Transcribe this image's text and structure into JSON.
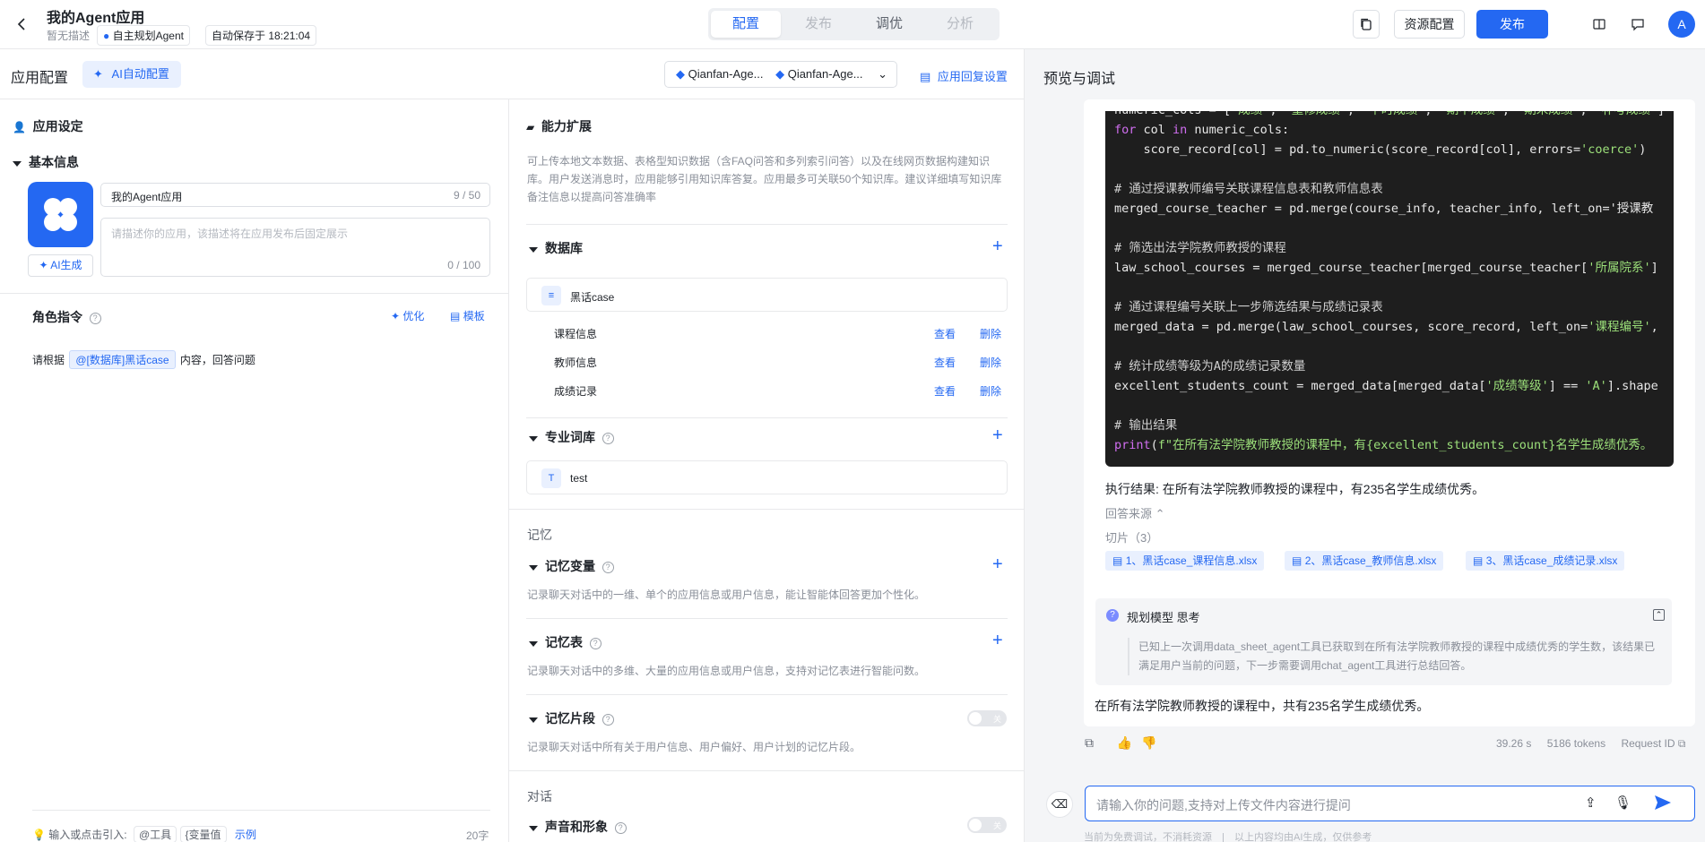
{
  "topbar": {
    "app_title": "我的Agent应用",
    "no_desc": "暂无描述",
    "agent_type": "自主规划Agent",
    "autosave": "自动保存于 18:21:04",
    "tabs": [
      "配置",
      "发布",
      "调优",
      "分析"
    ],
    "resource_btn": "资源配置",
    "publish_btn": "发布",
    "avatar": "A"
  },
  "config": {
    "title": "应用配置",
    "ai_auto": "AI自动配置",
    "model1": "Qianfan-Age...",
    "model2": "Qianfan-Age...",
    "reply_settings": "应用回复设置"
  },
  "app_settings": {
    "title": "应用设定",
    "basic_info": "基本信息",
    "name_value": "我的Agent应用",
    "name_count": "9 / 50",
    "desc_placeholder": "请描述你的应用，该描述将在应用发布后固定展示",
    "desc_count": "0 / 100",
    "ai_generate": "AI生成",
    "role_title": "角色指令",
    "optimize": "优化",
    "template": "模板",
    "instr_prefix": "请根据",
    "instr_tag": "@[数据库]黑话case",
    "instr_suffix": "内容，回答问题",
    "footer_hint": "输入或点击引入:",
    "footer_tool": "@工具",
    "footer_var": "{变量值",
    "footer_example": "示例",
    "footer_count": "20字"
  },
  "capability": {
    "title": "能力扩展",
    "desc": "可上传本地文本数据、表格型知识数据（含FAQ问答和多列索引问答）以及在线网页数据构建知识库。用户发送消息时，应用能够引用知识库答复。应用最多可关联50个知识库。建议详细填写知识库备注信息以提高问答准确率",
    "database": {
      "title": "数据库",
      "name": "黑话case",
      "tables": [
        {
          "name": "课程信息",
          "view": "查看",
          "del": "删除"
        },
        {
          "name": "教师信息",
          "view": "查看",
          "del": "删除"
        },
        {
          "name": "成绩记录",
          "view": "查看",
          "del": "删除"
        }
      ]
    },
    "terms": {
      "title": "专业词库",
      "item": "test"
    },
    "memory_label": "记忆",
    "mem_var": {
      "title": "记忆变量",
      "desc": "记录聊天对话中的一维、单个的应用信息或用户信息，能让智能体回答更加个性化。"
    },
    "mem_table": {
      "title": "记忆表",
      "desc": "记录聊天对话中的多维、大量的应用信息或用户信息，支持对记忆表进行智能问数。"
    },
    "mem_frag": {
      "title": "记忆片段",
      "desc": "记录聊天对话中所有关于用户信息、用户偏好、用户计划的记忆片段。",
      "toggle": "关"
    },
    "dialog_label": "对话",
    "voice": {
      "title": "声音和形象",
      "toggle": "关"
    }
  },
  "preview": {
    "title": "预览与调试",
    "code_lines": [
      "numeric_cols = ['成绩', '重修成绩', '平时成绩', '期中成绩', '期末成绩', '补考成绩']",
      "for col in numeric_cols:",
      "    score_record[col] = pd.to_numeric(score_record[col], errors='coerce')",
      "",
      "# 通过授课教师编号关联课程信息表和教师信息表",
      "merged_course_teacher = pd.merge(course_info, teacher_info, left_on='授课教",
      "",
      "# 筛选出法学院教师教授的课程",
      "law_school_courses = merged_course_teacher[merged_course_teacher['所属院系']",
      "",
      "# 通过课程编号关联上一步筛选结果与成绩记录表",
      "merged_data = pd.merge(law_school_courses, score_record, left_on='课程编号',",
      "",
      "# 统计成绩等级为A的成绩记录数量",
      "excellent_students_count = merged_data[merged_data['成绩等级'] == 'A'].shape",
      "",
      "# 输出结果",
      "print(f\"在所有法学院教师教授的课程中，有{excellent_students_count}名学生成绩优秀。"
    ],
    "exec_result": "执行结果: 在所有法学院教师教授的课程中，有235名学生成绩优秀。",
    "source_label": "回答来源",
    "slices_label": "切片（3）",
    "slices": [
      "1、黑话case_课程信息.xlsx",
      "2、黑话case_教师信息.xlsx",
      "3、黑话case_成绩记录.xlsx"
    ],
    "thinking_title": "规划模型 思考",
    "thinking_text": "已知上一次调用data_sheet_agent工具已获取到在所有法学院教师教授的课程中成绩优秀的学生数，该结果已满足用户当前的问题，下一步需要调用chat_agent工具进行总结回答。",
    "answer": "在所有法学院教师教授的课程中，共有235名学生成绩优秀。",
    "time": "39.26 s",
    "tokens": "5186 tokens",
    "request_id": "Request ID",
    "input_placeholder": "请输入你的问题,支持对上传文件内容进行提问",
    "disclaimer1": "当前为免费调试，不消耗资源",
    "disclaimer2": "以上内容均由AI生成，仅供参考"
  }
}
